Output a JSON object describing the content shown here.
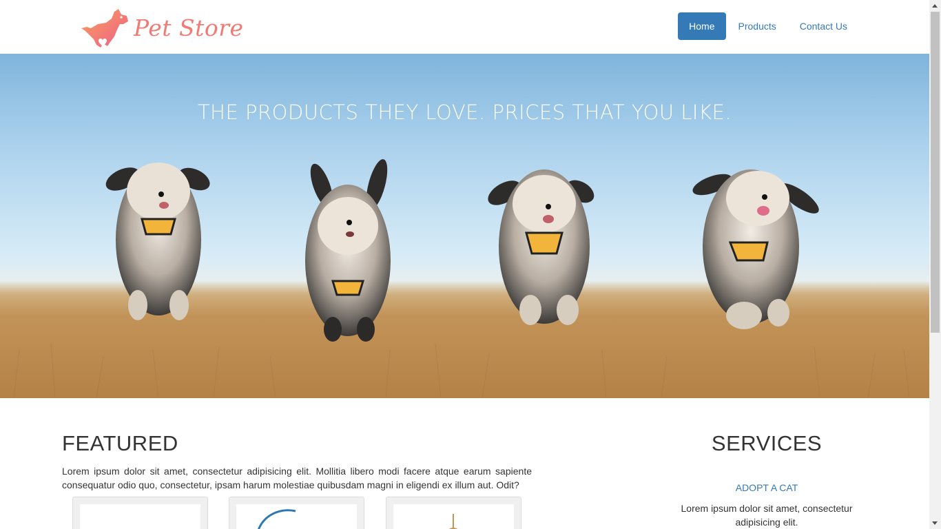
{
  "brand": {
    "name": "Pet Store",
    "logo_icon": "dog-logo-icon",
    "color": "#f07b74"
  },
  "nav": {
    "items": [
      {
        "label": "Home",
        "active": true
      },
      {
        "label": "Products",
        "active": false
      },
      {
        "label": "Contact Us",
        "active": false
      }
    ]
  },
  "hero": {
    "title": "THE PRODUCTS THEY LOVE. PRICES THAT YOU LIKE.",
    "image": "four dogs running in a field"
  },
  "featured": {
    "heading": "FEATURED",
    "text": "Lorem ipsum dolor sit amet, consectetur adipisicing elit. Mollitia libero modi facere atque earum sapiente consequatur odio quo, consectetur, ipsam harum molestiae quibusdam magni in eligendi ex illum aut. Odit?",
    "products": [
      {
        "image": "product-image"
      },
      {
        "image": "leash-image"
      },
      {
        "image": "toy-image"
      }
    ]
  },
  "services": {
    "heading": "SERVICES",
    "items": [
      {
        "title": "ADOPT A CAT",
        "text": "Lorem ipsum dolor sit amet, consectetur adipisicing elit."
      }
    ]
  },
  "colors": {
    "primary": "#337ab7",
    "text": "#333333"
  }
}
